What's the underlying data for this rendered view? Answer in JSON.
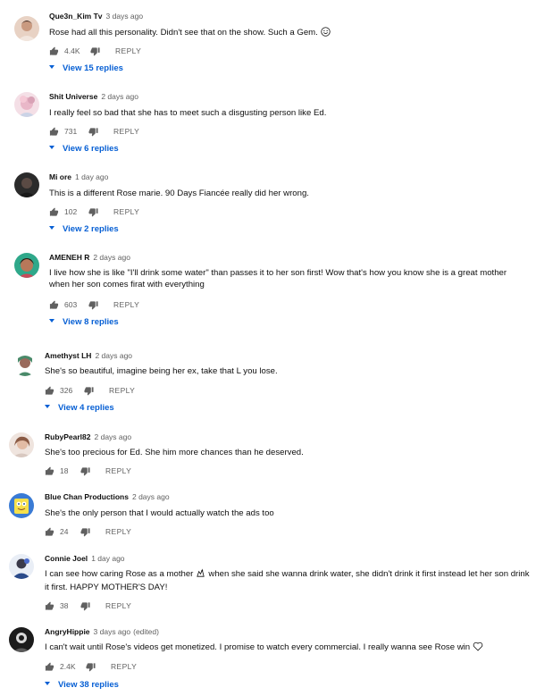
{
  "comments": [
    {
      "author": "Que3n_Kim Tv",
      "time": "3 days ago",
      "text": "Rose had all this personality. Didn't see that on the show. Such a Gem.",
      "trailing_icon": "smiley-icon",
      "likes": "4.4K",
      "reply_label": "REPLY",
      "replies_label": "View 15 replies"
    },
    {
      "author": "Shit Universe",
      "time": "2 days ago",
      "text": "I really feel so bad that she has to meet such a disgusting person like Ed.",
      "likes": "731",
      "reply_label": "REPLY",
      "replies_label": "View 6 replies"
    },
    {
      "author": "Mi ore",
      "time": "1 day ago",
      "text": "This is a different Rose marie. 90 Days Fiancée really did her wrong.",
      "likes": "102",
      "reply_label": "REPLY",
      "replies_label": "View 2 replies"
    },
    {
      "author": "AMENEH R",
      "time": "2 days ago",
      "text": "I live how she is like \"I'll drink some water\" than passes it to her son first! Wow that's how you know she is a great mother when her son comes firat with everything",
      "likes": "603",
      "reply_label": "REPLY",
      "replies_label": "View 8 replies"
    },
    {
      "author": "Amethyst LH",
      "time": "2 days ago",
      "text": "She's so beautiful, imagine being her ex, take that L you lose.",
      "likes": "326",
      "reply_label": "REPLY",
      "replies_label": "View 4 replies"
    },
    {
      "author": "RubyPearl82",
      "time": "2 days ago",
      "text": "She's too precious for Ed. She him more chances than he deserved.",
      "likes": "18",
      "reply_label": "REPLY"
    },
    {
      "author": "Blue Chan Productions",
      "time": "2 days ago",
      "text": "She's the only person that I would actually watch the ads too",
      "likes": "24",
      "reply_label": "REPLY"
    },
    {
      "author": "Connie Joel",
      "time": "1 day ago",
      "text_before_icon": "I can see how caring Rose as a mother",
      "inline_icon": "hands-emoji-icon",
      "text_after_icon": "when she said she wanna drink water, she didn't drink it first instead let her son drink it first. HAPPY MOTHER'S DAY!",
      "likes": "38",
      "reply_label": "REPLY"
    },
    {
      "author": "AngryHippie",
      "time": "3 days ago",
      "edited": "(edited)",
      "text": "I can't wait until Rose's videos get monetized. I promise to watch every commercial. I really wanna see Rose win",
      "trailing_icon": "heart-outline-icon",
      "likes": "2.4K",
      "reply_label": "REPLY",
      "replies_label": "View 38 replies"
    }
  ],
  "colors": {
    "link_blue": "#065fd4",
    "secondary_text": "#606060",
    "primary_text": "#0f0f0f"
  }
}
